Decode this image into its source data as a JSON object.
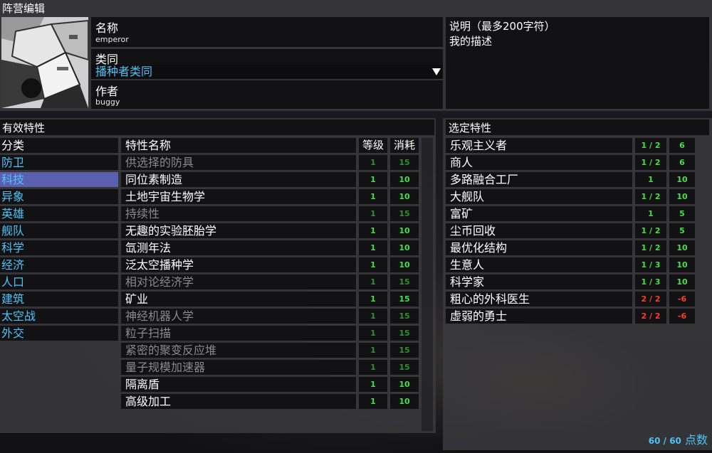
{
  "window_title": "阵营编辑",
  "faction": {
    "name_label": "名称",
    "name_value": "emperor",
    "species_label": "类同",
    "species_value": "播种者类同",
    "author_label": "作者",
    "author_value": "buggy",
    "desc_label": "说明（最多200字符）",
    "desc_value": "我的描述"
  },
  "available": {
    "header": "有效特性",
    "category_header": "分类",
    "trait_name_header": "特性名称",
    "level_header": "等级",
    "cost_header": "消耗",
    "categories": [
      "防卫",
      "科技",
      "异象",
      "英雄",
      "舰队",
      "科学",
      "经济",
      "人口",
      "建筑",
      "太空战",
      "外交"
    ],
    "selected_category": 1,
    "traits": [
      {
        "name": "供选择的防具",
        "level": "1",
        "cost": "15",
        "enabled": false
      },
      {
        "name": "同位素制造",
        "level": "1",
        "cost": "10",
        "enabled": true
      },
      {
        "name": "土地宇宙生物学",
        "level": "1",
        "cost": "10",
        "enabled": true
      },
      {
        "name": "持续性",
        "level": "1",
        "cost": "15",
        "enabled": false
      },
      {
        "name": "无趣的实验胚胎学",
        "level": "1",
        "cost": "10",
        "enabled": true
      },
      {
        "name": "氙测年法",
        "level": "1",
        "cost": "10",
        "enabled": true
      },
      {
        "name": "泛太空播种学",
        "level": "1",
        "cost": "10",
        "enabled": true
      },
      {
        "name": "相对论经济学",
        "level": "1",
        "cost": "15",
        "enabled": false
      },
      {
        "name": "矿业",
        "level": "1",
        "cost": "15",
        "enabled": true
      },
      {
        "name": "神经机器人学",
        "level": "1",
        "cost": "15",
        "enabled": false
      },
      {
        "name": "粒子扫描",
        "level": "1",
        "cost": "15",
        "enabled": false
      },
      {
        "name": "紧密的聚变反应堆",
        "level": "1",
        "cost": "15",
        "enabled": false
      },
      {
        "name": "量子规模加速器",
        "level": "1",
        "cost": "15",
        "enabled": false
      },
      {
        "name": "隔离盾",
        "level": "1",
        "cost": "10",
        "enabled": true
      },
      {
        "name": "高级加工",
        "level": "1",
        "cost": "10",
        "enabled": true
      }
    ]
  },
  "selected": {
    "header": "选定特性",
    "traits": [
      {
        "name": "乐观主义者",
        "level": "1 / 2",
        "cost": "6",
        "negative": false
      },
      {
        "name": "商人",
        "level": "1 / 2",
        "cost": "6",
        "negative": false
      },
      {
        "name": "多路融合工厂",
        "level": "1",
        "cost": "10",
        "negative": false
      },
      {
        "name": "大舰队",
        "level": "1 / 2",
        "cost": "10",
        "negative": false
      },
      {
        "name": "富矿",
        "level": "1",
        "cost": "5",
        "negative": false
      },
      {
        "name": "尘币回收",
        "level": "1 / 2",
        "cost": "5",
        "negative": false
      },
      {
        "name": "最优化结构",
        "level": "1 / 2",
        "cost": "10",
        "negative": false
      },
      {
        "name": "生意人",
        "level": "1 / 3",
        "cost": "10",
        "negative": false
      },
      {
        "name": "科学家",
        "level": "1 / 3",
        "cost": "10",
        "negative": false
      },
      {
        "name": "粗心的外科医生",
        "level": "2 / 2",
        "cost": "-6",
        "negative": true
      },
      {
        "name": "虚弱的勇士",
        "level": "2 / 2",
        "cost": "-6",
        "negative": true
      }
    ],
    "points_value": "60 / 60",
    "points_unit": "点数"
  },
  "colors": {
    "accent": "#4fc3f7",
    "selected_category": "#5b5fb0",
    "positive": "#46e046",
    "negative": "#ff3b2f"
  },
  "icons": {
    "portrait": "faction-portrait",
    "dropdown": "triangle-down"
  }
}
